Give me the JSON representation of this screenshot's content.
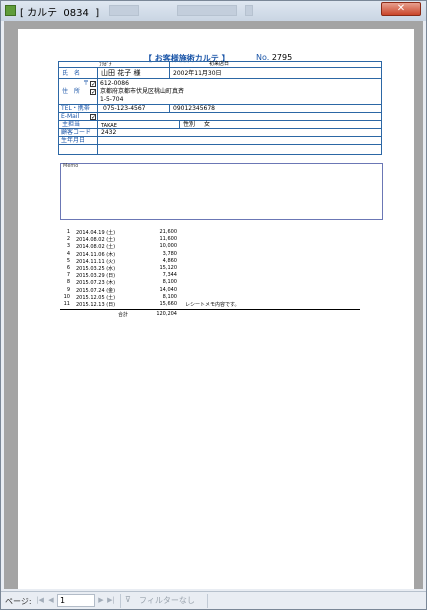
{
  "window": {
    "title": "[ カルテ  0834  ]",
    "close_label": "✕"
  },
  "report": {
    "heading": "【 お客様施術カルテ 】",
    "no_label": "No.",
    "no_value": "2795",
    "furigana_label": "ﾌﾘｶﾞﾅ",
    "first_visit_label": "初来店日",
    "name_label": "氏　名",
    "name_value": "山田 花子 様",
    "first_visit_value": "2002年11月30日",
    "address_label": "住　所",
    "postal_mark": "〒",
    "postal_code": "612-0086",
    "address_line1": "京都府京都市伏見区桃山町真斉",
    "address_line2": "1-5-704",
    "tel_label": "TEL・携帯",
    "tel_value": "075-123-4567",
    "mobile_value": "09012345678",
    "email_label": "E-Mail",
    "staff_label": "主担当",
    "staff_value": "TAKAE",
    "gender_label": "性別",
    "gender_value": "女",
    "customer_code_label": "顧客コード",
    "customer_code_value": "2432",
    "birthday_label": "生年月日",
    "memo_label": "Memo",
    "postal_checked": true,
    "email_checked": true
  },
  "history": [
    {
      "no": "1",
      "date": "2014.04.19 (土)",
      "amount": "21,600",
      "note": ""
    },
    {
      "no": "2",
      "date": "2014.08.02 (土)",
      "amount": "11,600",
      "note": ""
    },
    {
      "no": "3",
      "date": "2014.08.02 (土)",
      "amount": "10,000",
      "note": ""
    },
    {
      "no": "4",
      "date": "2014.11.06 (木)",
      "amount": "3,780",
      "note": ""
    },
    {
      "no": "5",
      "date": "2014.11.11 (火)",
      "amount": "4,860",
      "note": ""
    },
    {
      "no": "6",
      "date": "2015.03.25 (水)",
      "amount": "15,120",
      "note": ""
    },
    {
      "no": "7",
      "date": "2015.03.29 (日)",
      "amount": "7,344",
      "note": ""
    },
    {
      "no": "8",
      "date": "2015.07.23 (木)",
      "amount": "8,100",
      "note": ""
    },
    {
      "no": "9",
      "date": "2015.07.24 (金)",
      "amount": "14,040",
      "note": ""
    },
    {
      "no": "10",
      "date": "2015.12.05 (土)",
      "amount": "8,100",
      "note": ""
    },
    {
      "no": "11",
      "date": "2015.12.13 (日)",
      "amount": "15,660",
      "note": "レシートメモ内容です。"
    }
  ],
  "total": {
    "label": "合計",
    "value": "120,204"
  },
  "navbar": {
    "page_label": "ページ:",
    "first_btn": "|◀",
    "prev_btn": "◀",
    "page_value": "1",
    "next_btn": "▶",
    "last_btn": "▶|",
    "new_btn": "▶✱",
    "filter_label": "フィルターなし"
  }
}
